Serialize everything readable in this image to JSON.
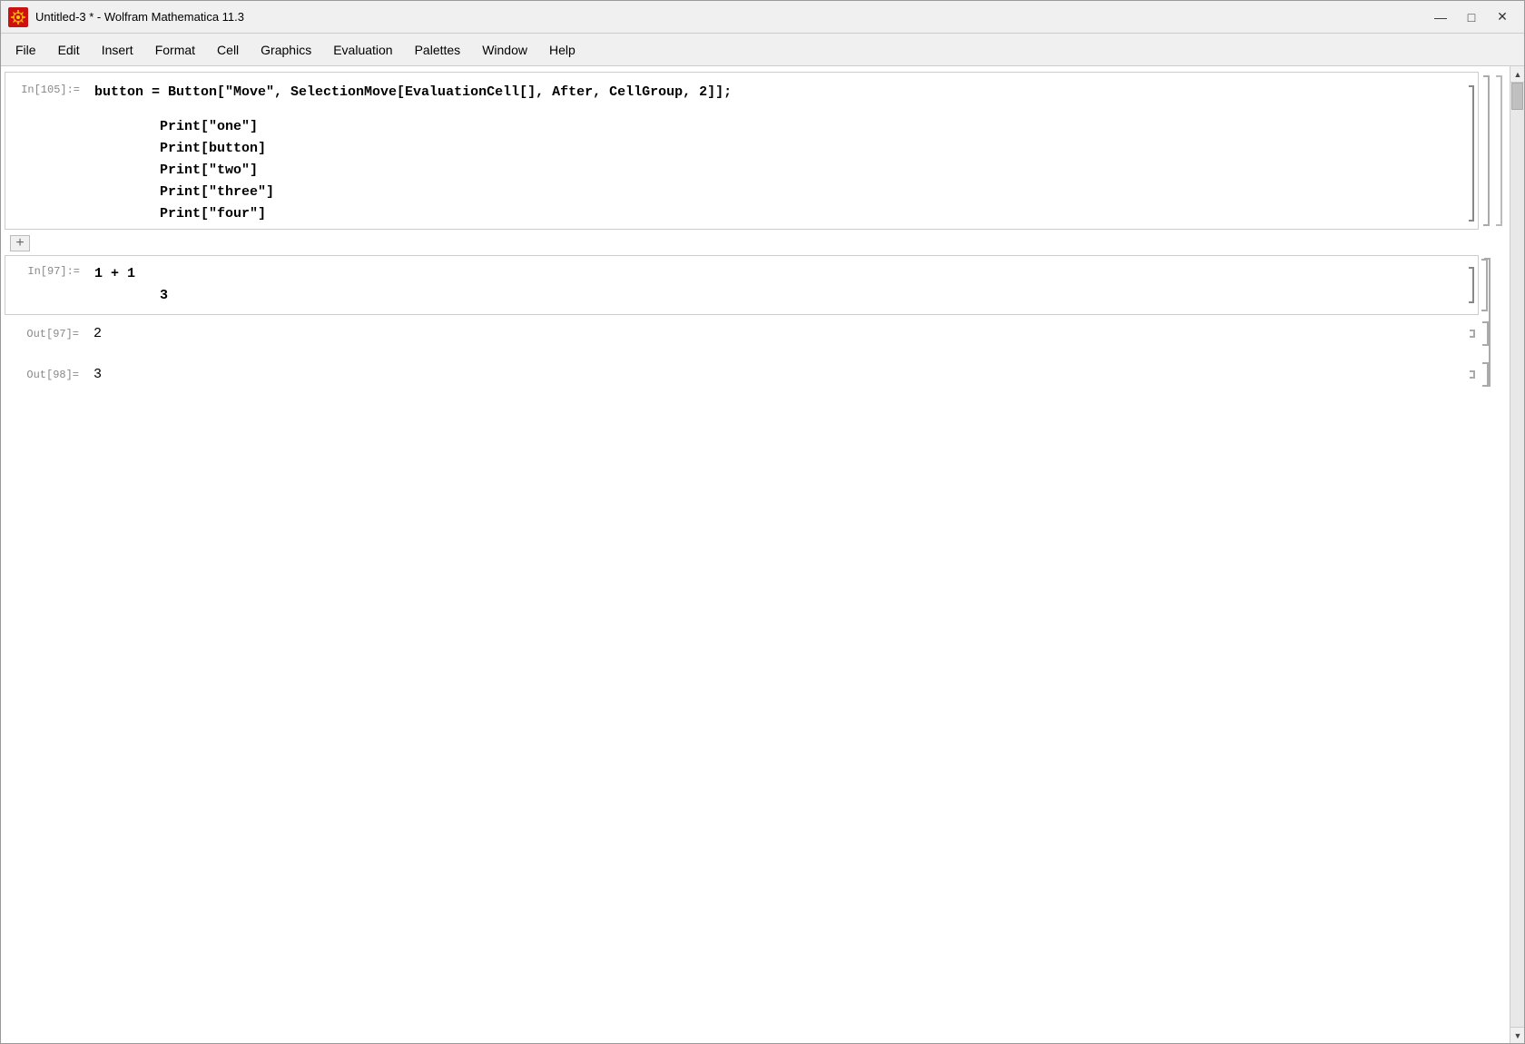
{
  "window": {
    "title": "Untitled-3 * - Wolfram Mathematica 11.3",
    "controls": {
      "minimize": "—",
      "maximize": "□",
      "close": "✕"
    }
  },
  "menu": {
    "items": [
      "File",
      "Edit",
      "Insert",
      "Format",
      "Cell",
      "Graphics",
      "Evaluation",
      "Palettes",
      "Window",
      "Help"
    ]
  },
  "cells": {
    "cell1": {
      "label": "In[105]:=",
      "code_line1": "button = Button[\"Move\", SelectionMove[EvaluationCell[], After, CellGroup, 2]];",
      "code_line2": "Print[\"one\"]",
      "code_line3": "Print[button]",
      "code_line4": "Print[\"two\"]",
      "code_line5": "Print[\"three\"]",
      "code_line6": "Print[\"four\"]"
    },
    "cell2": {
      "label": "In[97]:=",
      "code_line1": "1 + 1",
      "code_line2": "3"
    },
    "out97": {
      "label": "Out[97]=",
      "value": "2"
    },
    "out98": {
      "label": "Out[98]=",
      "value": "3"
    }
  },
  "icons": {
    "app_icon": "⚙",
    "add_cell": "+",
    "scroll_up": "▲",
    "scroll_down": "▼"
  }
}
